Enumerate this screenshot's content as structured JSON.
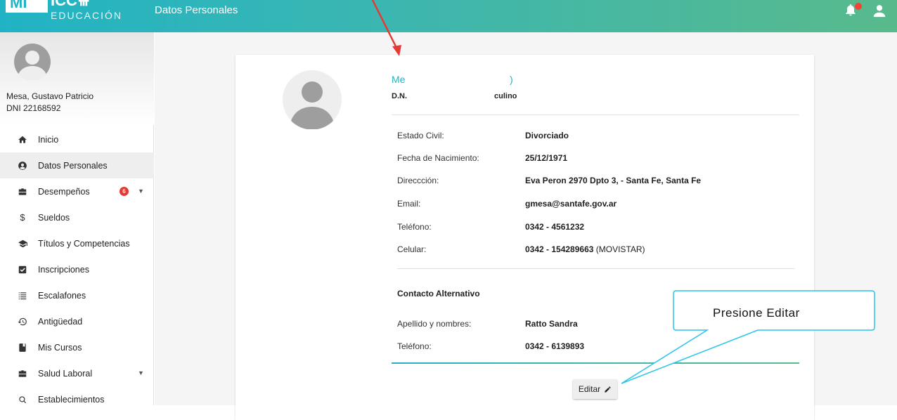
{
  "topbar": {
    "logo_top": "MI",
    "logo_sub": "EDUCACIÓN",
    "title": "Datos Personales",
    "icons": [
      "bell-icon",
      "user-icon"
    ]
  },
  "sidebar": {
    "profile": {
      "name": "Mesa, Gustavo Patricio",
      "dni": "DNI 22168592"
    },
    "items": [
      {
        "label": "Inicio",
        "icon": "home-icon",
        "glyph": "🏠"
      },
      {
        "label": "Datos Personales",
        "icon": "account-circle-icon",
        "glyph": "◉"
      },
      {
        "label": "Desempeños",
        "icon": "briefcase-icon",
        "glyph": "▪",
        "badge": "6"
      },
      {
        "label": "Sueldos",
        "icon": "dollar-icon",
        "glyph": "$"
      },
      {
        "label": "Títulos y Competencias",
        "icon": "graduation-cap-icon",
        "glyph": "▲"
      },
      {
        "label": "Inscripciones",
        "icon": "checkbox-icon",
        "glyph": "☑"
      },
      {
        "label": "Escalafones",
        "icon": "list-icon",
        "glyph": "☰"
      },
      {
        "label": "Antigüedad",
        "icon": "history-icon",
        "glyph": "↺"
      },
      {
        "label": "Mis Cursos",
        "icon": "book-icon",
        "glyph": "▮"
      },
      {
        "label": "Salud Laboral",
        "icon": "briefcase-icon",
        "glyph": "▪"
      },
      {
        "label": "Establecimientos",
        "icon": "search-icon",
        "glyph": "○"
      }
    ]
  },
  "card": {
    "name_part1": "Me",
    "name_part2": ")",
    "dni_part1": "D.N.",
    "dni_part2": "culino",
    "fields": [
      {
        "label": "Estado Civil:",
        "value": "Divorciado"
      },
      {
        "label": "Fecha de Nacimiento:",
        "value": "25/12/1971"
      },
      {
        "label": "Direccción:",
        "value": "Eva Peron 2970 Dpto 3, - Santa Fe, Santa Fe"
      },
      {
        "label": "Email:",
        "value": "gmesa@santafe.gov.ar"
      },
      {
        "label": "Teléfono:",
        "value": "0342 - 4561232"
      },
      {
        "label": "Celular:",
        "value": "0342 - 154289663",
        "extra": " (MOVISTAR)"
      }
    ],
    "contact_title": "Contacto Alternativo",
    "contact_fields": [
      {
        "label": "Apellido y nombres:",
        "value": "Ratto Sandra"
      },
      {
        "label": "Teléfono:",
        "value": "0342 - 6139893"
      }
    ],
    "edit_label": "Editar"
  },
  "annotation": {
    "callout_text": "Presione Editar",
    "arrow_color": "#e53935",
    "callout_border": "#29c5ea"
  }
}
